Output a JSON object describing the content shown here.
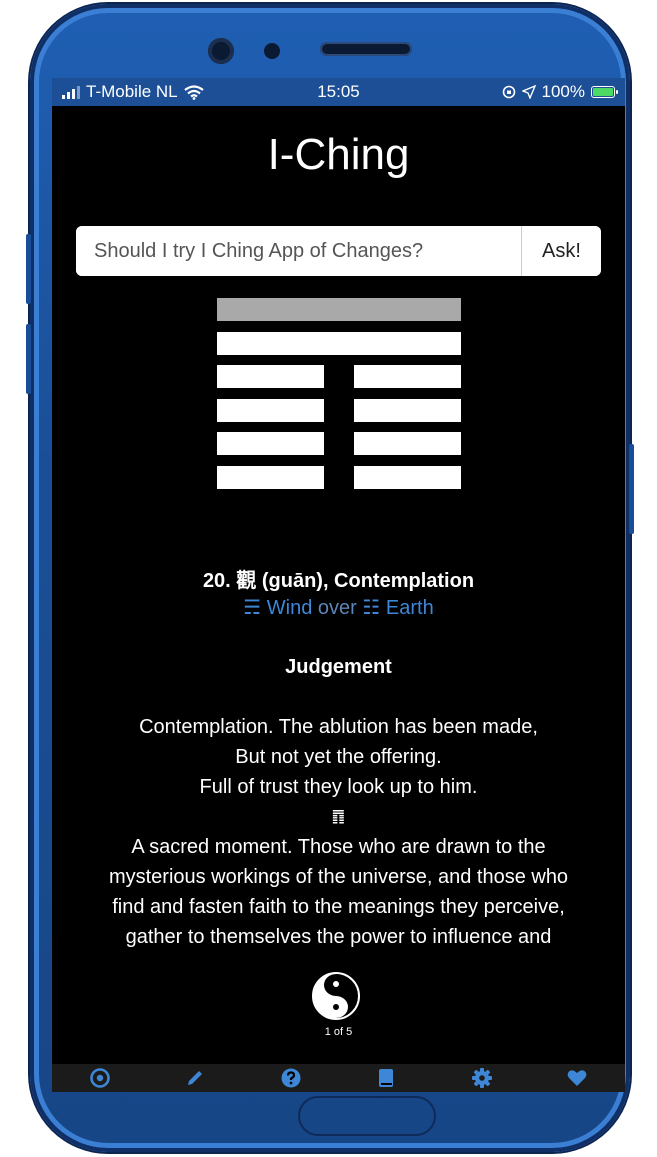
{
  "status_bar": {
    "carrier": "T-Mobile NL",
    "time": "15:05",
    "battery": "100%"
  },
  "app": {
    "title": "I-Ching"
  },
  "ask": {
    "placeholder": "Should I try I Ching App of Changes?",
    "button_label": "Ask!"
  },
  "hexagram": {
    "lines_top_to_bottom": [
      "yang-changing",
      "yang",
      "yin",
      "yin",
      "yin",
      "yin"
    ],
    "title": "20. 觀 (guān), Contemplation",
    "upper_symbol": "☴",
    "upper_trigram": "Wind",
    "over_word": "over",
    "lower_symbol": "☷",
    "lower_trigram": "Earth"
  },
  "judgement": {
    "heading": "Judgement",
    "lines": [
      "Contemplation. The ablution has been made,",
      "But not yet the offering.",
      "Full of trust they look up to him."
    ],
    "divider_symbol": "䷓",
    "commentary_lines": [
      "A sacred moment. Those who are drawn to the",
      "mysterious workings of the universe, and those who",
      "find and fasten faith to the meanings they perceive,",
      "gather to themselves the power to influence and"
    ]
  },
  "pager": {
    "label": "1 of 5"
  },
  "tabs": [
    {
      "name": "target-icon"
    },
    {
      "name": "pencil-icon"
    },
    {
      "name": "question-icon"
    },
    {
      "name": "book-icon"
    },
    {
      "name": "gear-icon"
    },
    {
      "name": "heart-icon"
    }
  ],
  "colors": {
    "accent": "#3e86d6",
    "status_bar": "#1c4f96",
    "phone_body": "#1f5fb3",
    "changing_line": "#a9a9a9"
  }
}
